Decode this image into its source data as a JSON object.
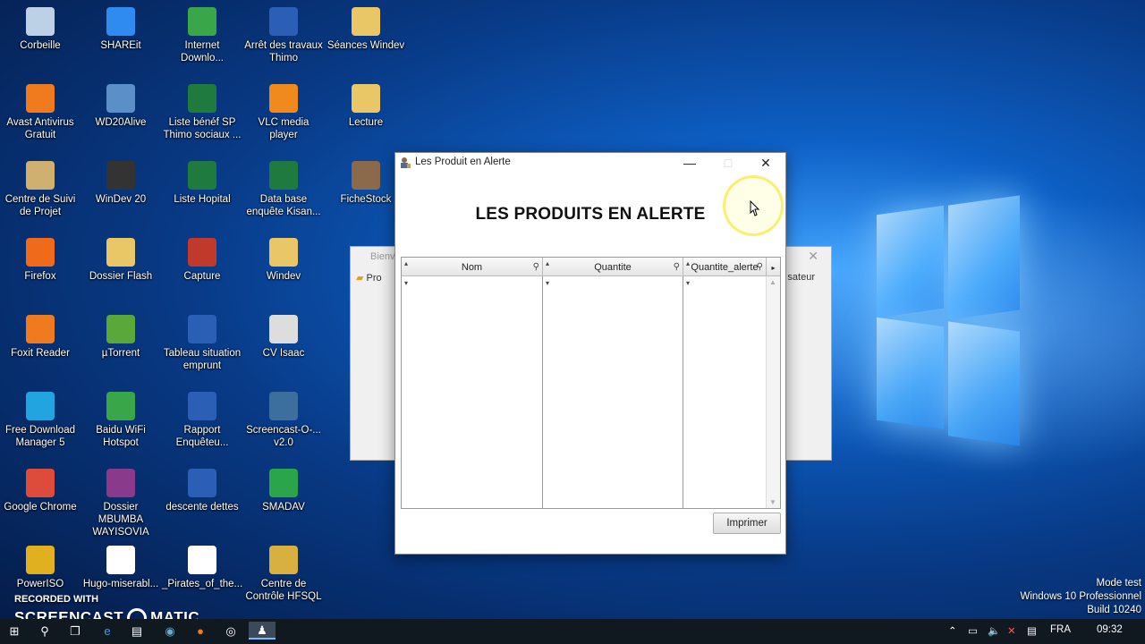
{
  "desktop_icons": [
    {
      "label": "Corbeille",
      "icon": "recycle-bin-icon",
      "color": "#bcd0e6"
    },
    {
      "label": "SHAREit",
      "icon": "shareit-icon",
      "color": "#2f8bf0"
    },
    {
      "label": "Internet Downlo...",
      "icon": "idm-icon",
      "color": "#3aa64a"
    },
    {
      "label": "Arrêt des travaux Thimo",
      "icon": "word-doc-icon",
      "color": "#2b5fb6"
    },
    {
      "label": "Séances Windev",
      "icon": "folder-icon",
      "color": "#e9c766"
    },
    {
      "label": "Avast Antivirus Gratuit",
      "icon": "avast-icon",
      "color": "#f07a1e"
    },
    {
      "label": "WD20Alive",
      "icon": "wd20alive-icon",
      "color": "#5a8fc8"
    },
    {
      "label": "Liste bénéf SP Thimo sociaux ...",
      "icon": "excel-doc-icon",
      "color": "#1f7a3f"
    },
    {
      "label": "VLC media player",
      "icon": "vlc-icon",
      "color": "#f08a1c"
    },
    {
      "label": "Lecture",
      "icon": "folder-icon",
      "color": "#e9c766"
    },
    {
      "label": "Centre de Suivi de Projet",
      "icon": "project-icon",
      "color": "#d0b070"
    },
    {
      "label": "WinDev 20",
      "icon": "windev-icon",
      "color": "#333333"
    },
    {
      "label": "Liste Hopital",
      "icon": "excel-doc-icon",
      "color": "#1f7a3f"
    },
    {
      "label": "Data base enquête Kisan...",
      "icon": "excel-doc-icon",
      "color": "#1f7a3f"
    },
    {
      "label": "FicheStock",
      "icon": "fichestock-icon",
      "color": "#8a6a4a"
    },
    {
      "label": "Firefox",
      "icon": "firefox-icon",
      "color": "#f06a1c"
    },
    {
      "label": "Dossier Flash",
      "icon": "folder-zip-icon",
      "color": "#e9c766"
    },
    {
      "label": "Capture",
      "icon": "capture-icon",
      "color": "#c0392b"
    },
    {
      "label": "Windev",
      "icon": "folder-zip-icon",
      "color": "#e9c766"
    },
    {
      "label": "Foxit Reader",
      "icon": "foxit-icon",
      "color": "#f07a1e"
    },
    {
      "label": "µTorrent",
      "icon": "utorrent-icon",
      "color": "#5aa83a"
    },
    {
      "label": "Tableau situation emprunt",
      "icon": "word-doc-icon",
      "color": "#2b5fb6"
    },
    {
      "label": "CV Isaac",
      "icon": "document-icon",
      "color": "#dddddd"
    },
    {
      "label": "Free Download Manager 5",
      "icon": "fdm-icon",
      "color": "#22a4e0"
    },
    {
      "label": "Baidu WiFi Hotspot",
      "icon": "wifi-icon",
      "color": "#3aa64a"
    },
    {
      "label": "Rapport Enquêteu...",
      "icon": "word-doc-icon",
      "color": "#2b5fb6"
    },
    {
      "label": "Screencast-O-... v2.0",
      "icon": "screencast-icon",
      "color": "#3c6e9e"
    },
    {
      "label": "Google Chrome",
      "icon": "chrome-icon",
      "color": "#de4b3a"
    },
    {
      "label": "Dossier MBUMBA WAYISOVIA",
      "icon": "winrar-icon",
      "color": "#8a3a8a"
    },
    {
      "label": "descente dettes",
      "icon": "word-doc-icon",
      "color": "#2b5fb6"
    },
    {
      "label": "SMADAV",
      "icon": "smadav-icon",
      "color": "#2aa54a"
    },
    {
      "label": "PowerISO",
      "icon": "poweriso-icon",
      "color": "#e0b020"
    },
    {
      "label": "Hugo-miserabl...",
      "icon": "pdf-icon",
      "color": "#ffffff"
    },
    {
      "label": "_Pirates_of_the...",
      "icon": "audio-file-icon",
      "color": "#ffffff"
    },
    {
      "label": "Centre de Contrôle HFSQL",
      "icon": "hfsql-icon",
      "color": "#d8b040"
    }
  ],
  "background_window": {
    "title": "Bienv",
    "item_left": "Pro",
    "item_right": "sateur"
  },
  "dialog": {
    "title": "Les Produit en Alerte",
    "minimize": "—",
    "maximize": "□",
    "close": "✕",
    "heading": "LES PRODUITS EN ALERTE",
    "columns": [
      "Nom",
      "Quantite",
      "Quantite_alerte"
    ],
    "rows": [],
    "print_button": "Imprimer"
  },
  "watermark": {
    "line1": "Mode test",
    "line2": "Windows 10 Professionnel",
    "line3": "Build 10240"
  },
  "screencast": {
    "recorded_with": "RECORDED WITH",
    "brand_left": "SCREENCAST",
    "brand_right": "MATIC"
  },
  "taskbar": {
    "language": "FRA",
    "time": "09:32"
  }
}
